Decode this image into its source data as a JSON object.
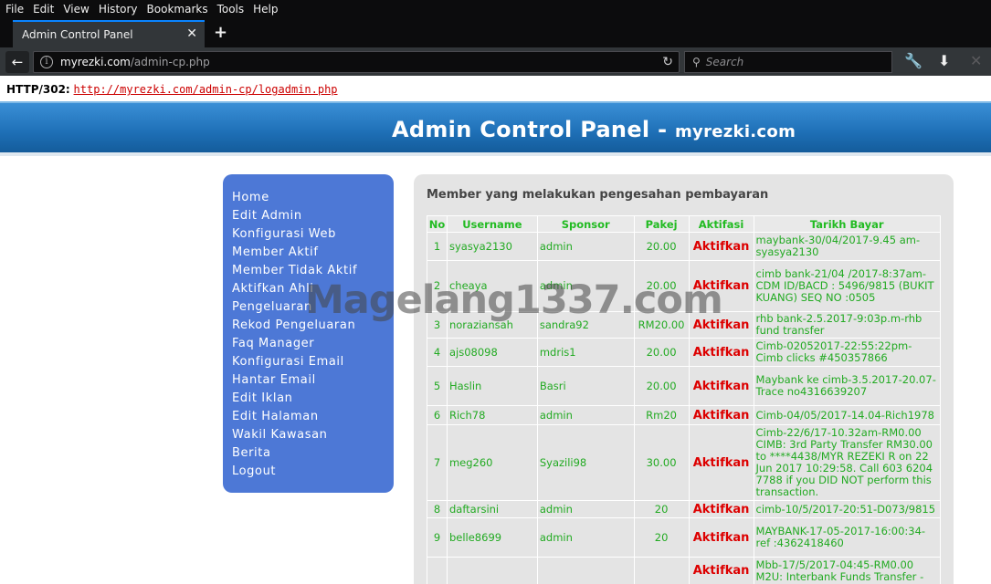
{
  "browser": {
    "menu": [
      "File",
      "Edit",
      "View",
      "History",
      "Bookmarks",
      "Tools",
      "Help"
    ],
    "tab_title": "Admin Control Panel",
    "url_host": "myrezki.com",
    "url_path": "/admin-cp.php",
    "search_placeholder": "Search"
  },
  "http": {
    "status": "HTTP/302:",
    "link": "http://myrezki.com/admin-cp/logadmin.php"
  },
  "banner": {
    "title": "Admin Control Panel - ",
    "site": "myrezki.com"
  },
  "sidebar": {
    "items": [
      "Home",
      "Edit Admin",
      "Konfigurasi Web",
      "Member Aktif",
      "Member Tidak Aktif",
      "Aktifkan Ahli",
      "Pengeluaran",
      "Rekod Pengeluaran",
      "Faq Manager",
      "Konfigurasi Email",
      "Hantar Email",
      "Edit Iklan",
      "Edit Halaman",
      "Wakil Kawasan",
      "Berita",
      "Logout"
    ]
  },
  "main": {
    "title": "Member yang melakukan pengesahan pembayaran",
    "columns": [
      "No",
      "Username",
      "Sponsor",
      "Pakej",
      "Aktifasi",
      "Tarikh Bayar"
    ],
    "rows": [
      {
        "no": "1",
        "username": "syasya2130",
        "sponsor": "admin",
        "pakej": "20.00",
        "aktifasi": "Aktifkan",
        "tarikh": "maybank-30/04/2017-9.45 am-syasya2130"
      },
      {
        "no": "2",
        "username": "cheaya",
        "sponsor": "admin",
        "pakej": "20.00",
        "aktifasi": "Aktifkan",
        "tarikh": "cimb bank-21/04 /2017-8:37am-CDM ID/BACD : 5496/9815 (BUKIT KUANG) SEQ NO :0505"
      },
      {
        "no": "3",
        "username": "noraziansah",
        "sponsor": "sandra92",
        "pakej": "RM20.00",
        "aktifasi": "Aktifkan",
        "tarikh": "rhb bank-2.5.2017-9:03p.m-rhb fund transfer"
      },
      {
        "no": "4",
        "username": "ajs08098",
        "sponsor": "mdris1",
        "pakej": "20.00",
        "aktifasi": "Aktifkan",
        "tarikh": "Cimb-02052017-22:55:22pm-Cimb clicks #450357866"
      },
      {
        "no": "5",
        "username": "Haslin",
        "sponsor": "Basri",
        "pakej": "20.00",
        "aktifasi": "Aktifkan",
        "tarikh": "Maybank ke cimb-3.5.2017-20.07-Trace no4316639207"
      },
      {
        "no": "6",
        "username": "Rich78",
        "sponsor": "admin",
        "pakej": "Rm20",
        "aktifasi": "Aktifkan",
        "tarikh": "Cimb-04/05/2017-14.04-Rich1978"
      },
      {
        "no": "7",
        "username": "meg260",
        "sponsor": "Syazili98",
        "pakej": "30.00",
        "aktifasi": "Aktifkan",
        "tarikh": "Cimb-22/6/17-10.32am-RM0.00 CIMB: 3rd Party Transfer RM30.00 to ****4438/MYR REZEKI R on 22 Jun 2017 10:29:58. Call 603 6204 7788 if you DID NOT perform this transaction."
      },
      {
        "no": "8",
        "username": "daftarsini",
        "sponsor": "admin",
        "pakej": "20",
        "aktifasi": "Aktifkan",
        "tarikh": "cimb-10/5/2017-20:51-D073/9815"
      },
      {
        "no": "9",
        "username": "belle8699",
        "sponsor": "admin",
        "pakej": "20",
        "aktifasi": "Aktifkan",
        "tarikh": "MAYBANK-17-05-2017-16:00:34-ref :4362418460"
      },
      {
        "no": "",
        "username": "",
        "sponsor": "",
        "pakej": "",
        "aktifasi": "Aktifkan",
        "tarikh": "Mbb-17/5/2017-04:45-RM0.00 M2U: Interbank Funds Transfer -"
      }
    ]
  },
  "watermark": "Magelang1337.com"
}
